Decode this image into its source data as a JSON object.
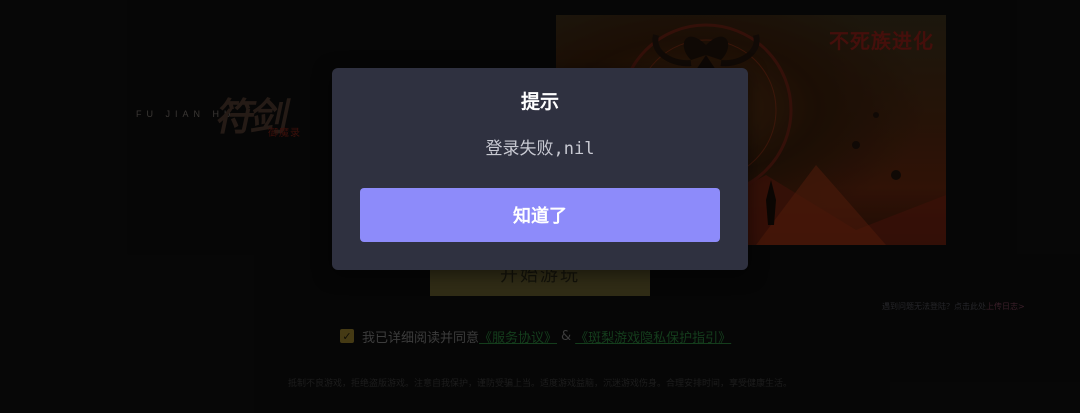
{
  "logo": {
    "latin": "FU JIAN HU",
    "title": "符剑",
    "subtitle": "御魔录"
  },
  "banner": {
    "title": "不死族进化"
  },
  "start_button": {
    "label": "开始游玩"
  },
  "help_link": {
    "text": "遇到问题无法登陆？点击此处",
    "link": "上传日志>"
  },
  "agreement": {
    "checked": true,
    "prefix": "我已详细阅读并同意",
    "service_link": "《服务协议》",
    "connector": "&",
    "privacy_link": "《斑梨游戏隐私保护指引》"
  },
  "health_notice": "抵制不良游戏，拒绝盗版游戏。注意自我保护，谨防受骗上当。适度游戏益脑，沉迷游戏伤身。合理安排时间，享受健康生活。",
  "dialog": {
    "title": "提示",
    "message": "登录失败,nil",
    "confirm_label": "知道了"
  },
  "colors": {
    "dialog_bg": "#2f3140",
    "dialog_button": "#8d8bfa",
    "agree_link": "#1f5e2c"
  }
}
